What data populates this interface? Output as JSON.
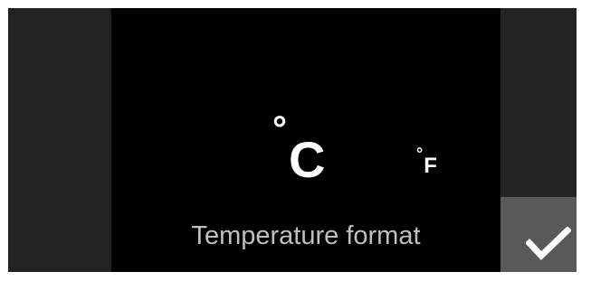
{
  "screen": {
    "title": "Temperature format",
    "options": [
      {
        "degree": "°",
        "letter": "C",
        "selected": true
      },
      {
        "degree": "°",
        "letter": "F",
        "selected": false
      }
    ],
    "confirm_icon": "checkmark-icon"
  },
  "colors": {
    "background": "#000000",
    "side_panel": "#222222",
    "confirm_button": "#595959",
    "text_primary": "#ffffff",
    "text_label": "#bfbfbf"
  }
}
